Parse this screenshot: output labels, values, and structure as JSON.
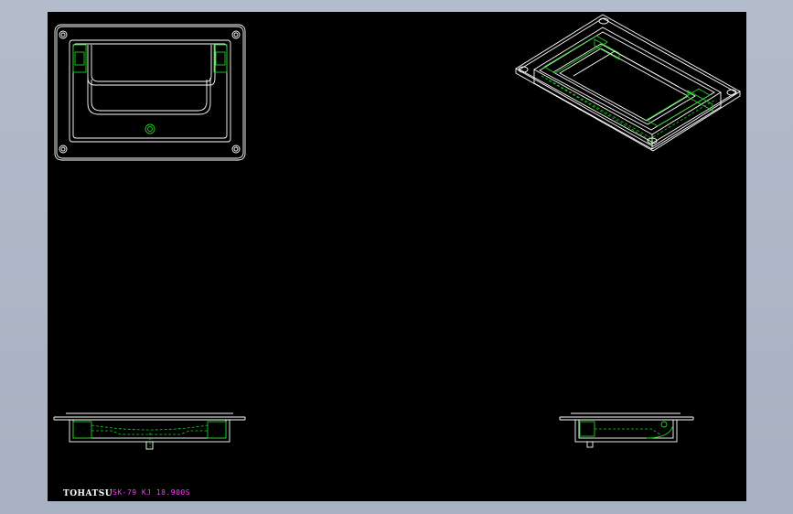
{
  "drawing": {
    "brand_text": "TOHATSU",
    "part_code": "SK-79 KJ 18.900S",
    "colors": {
      "background": "#000000",
      "frame": "#a7b1c1",
      "outline": "#ffffff",
      "hidden_lines": "#19d219",
      "annotation": "#ff33ff"
    }
  },
  "views": [
    {
      "name": "top-view"
    },
    {
      "name": "isometric-view"
    },
    {
      "name": "front-view"
    },
    {
      "name": "side-view"
    }
  ]
}
